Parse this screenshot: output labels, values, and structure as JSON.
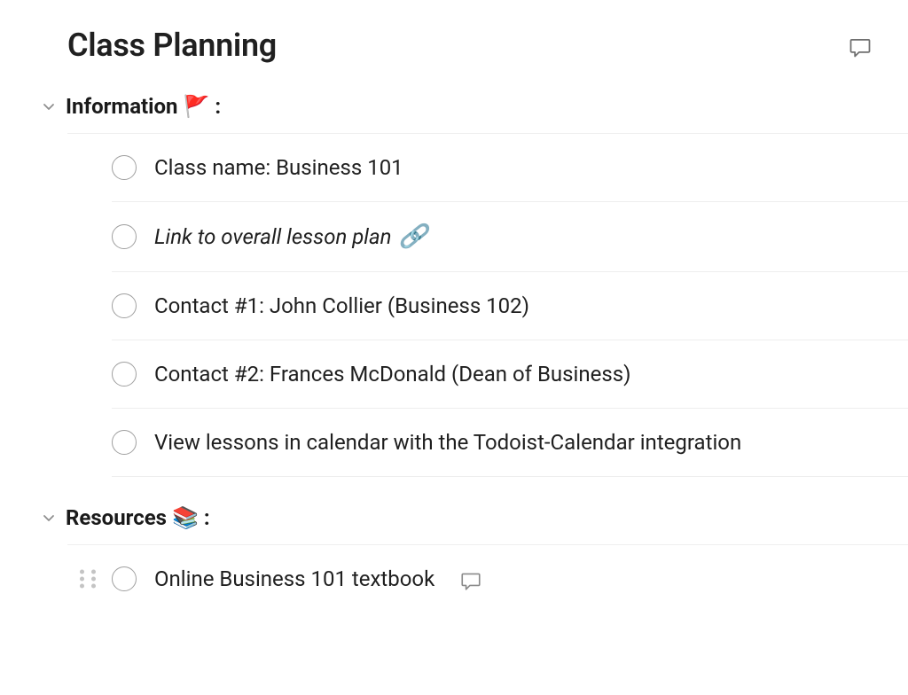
{
  "header": {
    "title": "Class Planning"
  },
  "sections": [
    {
      "title": "Information",
      "emoji": "🚩",
      "tasks": [
        {
          "text": "Class name: Business 101",
          "italic": false,
          "link": false
        },
        {
          "text": "Link to overall lesson plan",
          "italic": true,
          "link": true
        },
        {
          "text": "Contact #1: John Collier (Business 102)",
          "italic": false,
          "link": false
        },
        {
          "text": "Contact #2: Frances McDonald (Dean of Business)",
          "italic": false,
          "link": false
        },
        {
          "text": "View lessons in calendar with the Todoist-Calendar integration",
          "italic": false,
          "link": false
        }
      ]
    },
    {
      "title": "Resources",
      "emoji": "📚",
      "tasks": [
        {
          "text": "Online Business 101 textbook",
          "italic": false,
          "link": false,
          "drag": true,
          "comment": true
        }
      ]
    }
  ],
  "section_suffix": ":"
}
